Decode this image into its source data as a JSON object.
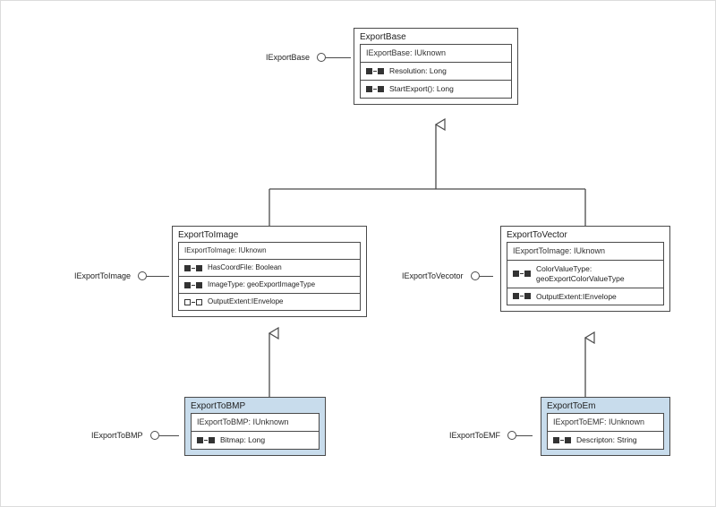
{
  "chart_data": {
    "type": "uml-class-diagram",
    "relations": [
      {
        "from": "ExportToImage",
        "to": "ExportBase",
        "kind": "generalization"
      },
      {
        "from": "ExportToVector",
        "to": "ExportBase",
        "kind": "generalization"
      },
      {
        "from": "ExportToBMP",
        "to": "ExportToImage",
        "kind": "generalization"
      },
      {
        "from": "ExportToEm",
        "to": "ExportToVector",
        "kind": "generalization"
      }
    ]
  },
  "classes": {
    "exportBase": {
      "title": "ExportBase",
      "interfaceHead": "IExportBase: IUknown",
      "rows": [
        {
          "marker": "rw",
          "text": "Resolution: Long"
        },
        {
          "marker": "rw",
          "text": "StartExport(): Long"
        }
      ],
      "lollipop": "IExportBase"
    },
    "exportToImage": {
      "title": "ExportToImage",
      "interfaceHead": "IExportToImage: IUknown",
      "rows": [
        {
          "marker": "rw",
          "text": "HasCoordFile: Boolean"
        },
        {
          "marker": "rw",
          "text": "ImageType: geoExportImageType"
        },
        {
          "marker": "wo",
          "text": "OutputExtent:IEnvelope"
        }
      ],
      "lollipop": "IExportToImage"
    },
    "exportToVector": {
      "title": "ExportToVector",
      "interfaceHead": "IExportToImage: IUknown",
      "rows": [
        {
          "marker": "rw",
          "text": "ColorValueType: geoExportColorValueType"
        },
        {
          "marker": "rw",
          "text": "OutputExtent:IEnvelope"
        }
      ],
      "lollipop": "IExportToVecotor"
    },
    "exportToBMP": {
      "title": "ExportToBMP",
      "interfaceHead": "IExportToBMP: IUnknown",
      "rows": [
        {
          "marker": "rw",
          "text": "Bitmap: Long"
        }
      ],
      "lollipop": "IExportToBMP"
    },
    "exportToEm": {
      "title": "ExportToEm",
      "interfaceHead": "IExportToEMF: IUnknown",
      "rows": [
        {
          "marker": "rw",
          "text": "Descripton: String"
        }
      ],
      "lollipop": "IExportToEMF"
    }
  }
}
